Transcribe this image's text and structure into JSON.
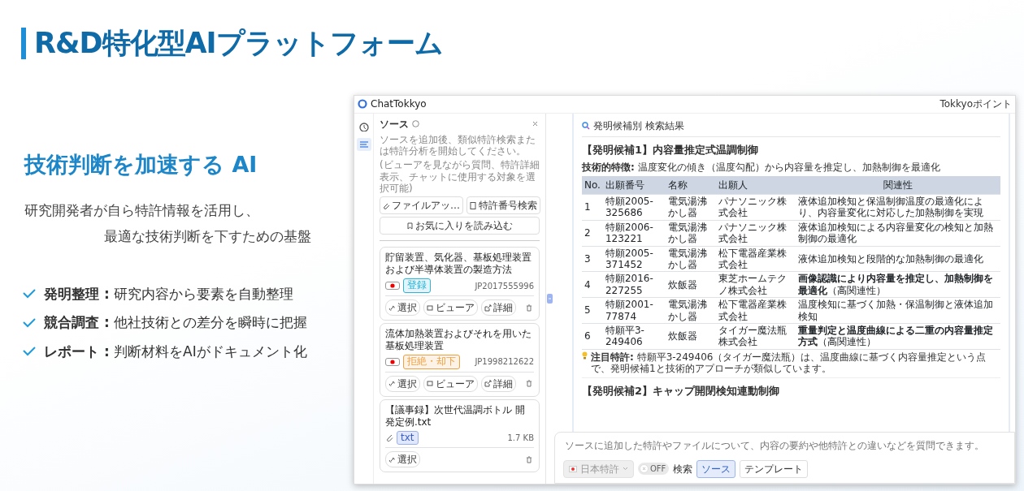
{
  "hero": {
    "title": "R&D特化型AIプラットフォーム",
    "subtitle": "技術判断を加速する AI",
    "lead": [
      "研究開発者が自ら特許情報を活用し、",
      "最適な技術判断を下すための基盤"
    ],
    "features": [
      {
        "label": "発明整理 :",
        "text": "研究内容から要素を自動整理"
      },
      {
        "label": "競合調査 :",
        "text": "他社技術との差分を瞬時に把握"
      },
      {
        "label": "レポート :",
        "text": "判断材料をAIがドキュメント化"
      }
    ]
  },
  "app": {
    "brand": "ChatTokkyo",
    "points_label": "Tokkyoポイント",
    "rail": [
      {
        "kind": "history",
        "selected": false
      },
      {
        "kind": "sources",
        "selected": true
      }
    ],
    "sources": {
      "title": "ソース",
      "description": "ソースを追加後、類似特許検索または特許分析を開始してください。",
      "hint": "(ビューアを見ながら質問、特許詳細表示、チャットに使用する対象を選択可能)",
      "buttons": [
        "ファイルアッ…",
        "特許番号検索"
      ],
      "favorites_button": "お気に入りを読み込む",
      "items": [
        {
          "kind": "patent",
          "title": "貯留装置、気化器、基板処理装置および半導体装置の製造方法",
          "status": {
            "label": "登録",
            "color": "#2bb5d8"
          },
          "number": "JP2017555996",
          "actions": [
            "選択",
            "ビューア",
            "詳細"
          ]
        },
        {
          "kind": "patent",
          "title": "流体加熱装置およびそれを用いた基板処理装置",
          "status": {
            "label": "拒絶・却下",
            "color": "#f0a040"
          },
          "number": "JP1998212622",
          "actions": [
            "選択",
            "ビューア",
            "詳細"
          ]
        },
        {
          "kind": "file",
          "title": "【議事録】次世代温調ボトル 開発定例.txt",
          "ext": "txt",
          "size": "1.7 KB",
          "actions": [
            "選択"
          ]
        }
      ]
    },
    "results": {
      "heading": "発明候補別 検索結果",
      "candidates": [
        {
          "title": "【発明候補1】内容量推定式温調制御",
          "feature_label": "技術的特徴:",
          "feature": "温度変化の傾き（温度勾配）から内容量を推定し、加熱制御を最適化",
          "columns": [
            "No.",
            "出願番号",
            "名称",
            "出願人",
            "関連性"
          ],
          "rows": [
            [
              "1",
              "特願2005-325686",
              "電気湯沸かし器",
              "パナソニック株式会社",
              "液体追加検知と保温制御温度の最適化により、内容量変化に対応した加熱制御を実現"
            ],
            [
              "2",
              "特願2006-123221",
              "電気湯沸かし器",
              "パナソニック株式会社",
              "液体追加検知による内容量変化の検知と加熱制御の最適化"
            ],
            [
              "3",
              "特願2005-371452",
              "電気湯沸かし器",
              "松下電器産業株式会社",
              "液体追加検知と段階的な加熱制御の最適化"
            ],
            [
              "4",
              "特願2016-227255",
              "炊飯器",
              "東芝ホームテクノ株式会社",
              "**画像認識により内容量を推定し、加熱制御を最適化**（高関連性）"
            ],
            [
              "5",
              "特願2001-77874",
              "電気湯沸かし器",
              "松下電器産業株式会社",
              "温度検知に基づく加熱・保温制御と液体追加検知"
            ],
            [
              "6",
              "特願平3-249406",
              "炊飯器",
              "タイガー魔法瓶株式会社",
              "**重量判定と温度曲線による二重の内容量推定方式**（高関連性）"
            ]
          ],
          "note_label": "注目特許:",
          "note": "特願平3-249406（タイガー魔法瓶）は、温度曲線に基づく内容量推定という点で、発明候補1と技術的アプローチが類似しています。"
        },
        {
          "title": "【発明候補2】キャップ開閉検知連動制御"
        }
      ]
    },
    "chat": {
      "placeholder": "ソースに追加した特許やファイルについて、内容の要約や他特許との違いなどを質問できます。",
      "country": "日本特許",
      "search_toggle": {
        "label": "検索",
        "on": false,
        "text": "OFF"
      },
      "tabs": [
        {
          "label": "ソース",
          "selected": true
        },
        {
          "label": "テンプレート",
          "selected": false
        }
      ]
    }
  }
}
